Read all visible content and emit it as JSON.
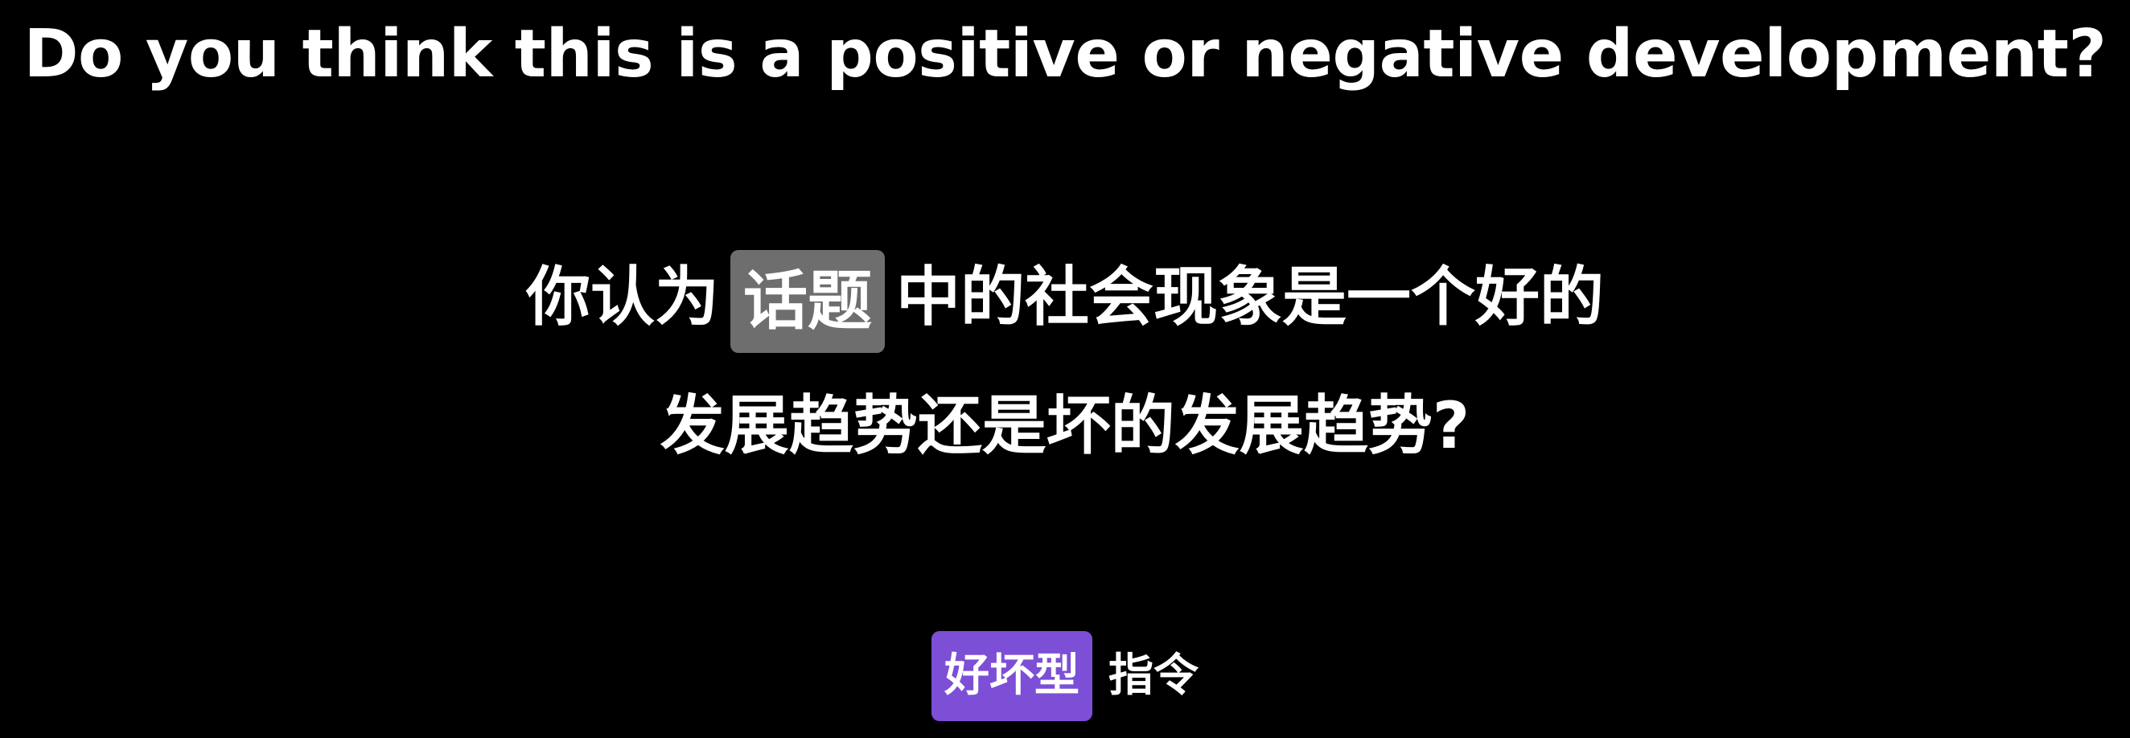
{
  "heading": "Do you think this is a positive or negative development?",
  "question": {
    "line1_prefix": "你认为",
    "topic_tag": "话题",
    "line1_suffix": "中的社会现象是一个好的",
    "line2": "发展趋势还是坏的发展趋势?"
  },
  "footer": {
    "type_tag": "好坏型",
    "label": "指令"
  },
  "colors": {
    "background": "#000000",
    "text": "#ffffff",
    "topic_tag_bg": "#6e6e6e",
    "type_tag_bg": "#7c4fd6"
  }
}
